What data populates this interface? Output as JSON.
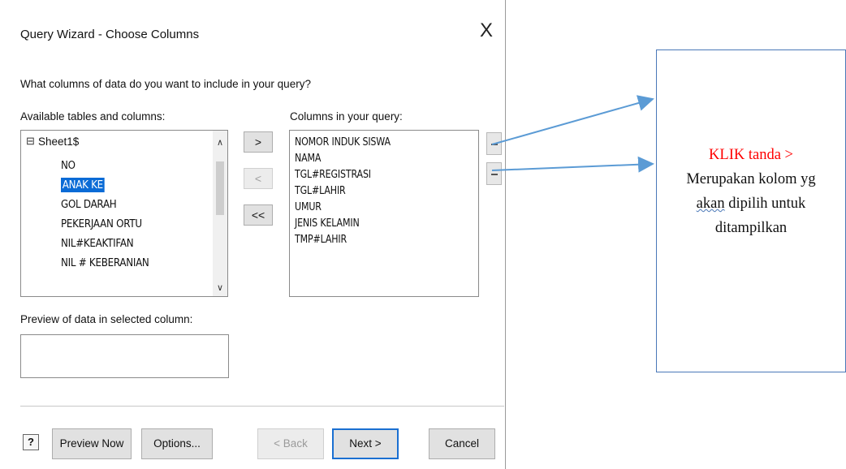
{
  "dialog": {
    "title": "Query Wizard - Choose Columns",
    "close_symbol": "X",
    "question": "What columns of data do you want to include in your query?",
    "available_label": "Available tables and columns:",
    "query_label": "Columns in your query:",
    "preview_label": "Preview of data in selected column:",
    "tree_root": "Sheet1$",
    "tree_expander": "⊟",
    "available_columns": [
      {
        "label": "NO",
        "selected": false
      },
      {
        "label": "ANAK KE",
        "selected": true
      },
      {
        "label": "GOL DARAH",
        "selected": false
      },
      {
        "label": "PEKERJAAN ORTU",
        "selected": false
      },
      {
        "label": "NIL#KEAKTIFAN",
        "selected": false
      },
      {
        "label": "NIL # KEBERANIAN",
        "selected": false
      }
    ],
    "query_columns": [
      "NOMOR INDUK SISWA",
      "NAMA",
      "TGL#REGISTRASI",
      "TGL#LAHIR",
      "UMUR",
      "JENIS KELAMIN",
      "TMP#LAHIR"
    ],
    "move_buttons": {
      "add": ">",
      "remove": "<",
      "remove_all": "<<"
    },
    "buttons": {
      "help": "?",
      "preview_now": "Preview Now",
      "options": "Options...",
      "back": "< Back",
      "next": "Next >",
      "cancel": "Cancel"
    },
    "icons": {
      "scroll_up": "∧",
      "scroll_down": "∨",
      "move_up": "move-up-icon",
      "move_down": "move-down-icon"
    }
  },
  "annotation": {
    "line1": "KLIK tanda >",
    "line2": "Merupakan kolom yg",
    "line3_underlined": "akan",
    "line3_rest": " dipilih untuk",
    "line4": "ditampilkan",
    "colors": {
      "highlight": "#ff0000",
      "border": "#4a78b8",
      "arrow": "#5b9bd5"
    }
  }
}
